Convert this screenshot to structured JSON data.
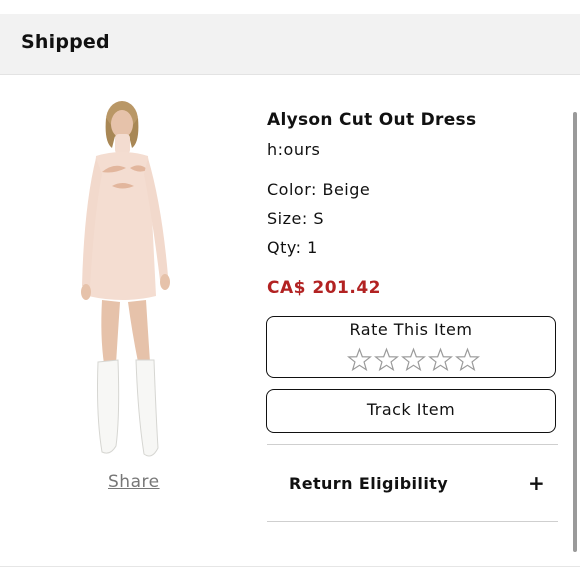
{
  "header": {
    "title": "Shipped"
  },
  "product": {
    "name": "Alyson Cut Out Dress",
    "brand": "h:ours",
    "color": "Color: Beige",
    "size": "Size: S",
    "qty": "Qty: 1",
    "price": "CA$ 201.42",
    "price_color": "#b22222",
    "image_icon": "dress-photo"
  },
  "actions": {
    "share_label": "Share",
    "rate_label": "Rate This Item",
    "rating": 0,
    "rating_max": 5,
    "track_label": "Track Item",
    "return_label": "Return Eligibility",
    "expand_icon": "+"
  }
}
